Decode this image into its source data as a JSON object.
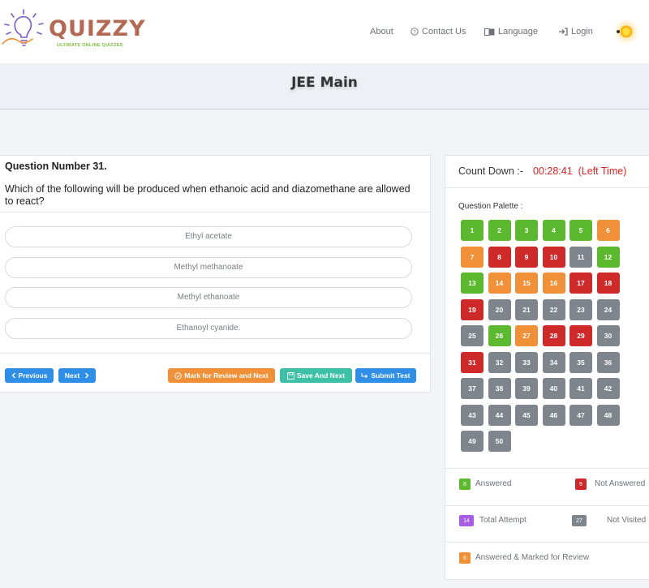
{
  "brand": {
    "name": "QUIZZY",
    "tagline": "ULTIMATE ONLINE QUIZZES"
  },
  "nav": {
    "about": "About",
    "contact": "Contact Us",
    "language": "Language",
    "login": "Login"
  },
  "page": {
    "title": "JEE Main"
  },
  "question": {
    "number_label": "Question Number 31.",
    "text": "Which of the following will be produced when ethanoic acid and diazomethane are allowed to react?",
    "options": [
      "Ethyl acetate",
      "Methyl methanoate",
      "Methyl ethanoate",
      "Ethanoyl cyanide."
    ]
  },
  "buttons": {
    "previous": "Previous",
    "next": "Next",
    "mark_review_next": "Mark for Review and Next",
    "save_next": "Save And Next",
    "submit": "Submit Test"
  },
  "countdown": {
    "label": "Count Down :-",
    "time": "00:28:41",
    "suffix": "(Left Time)"
  },
  "palette": {
    "label": "Question Palette :",
    "colors": {
      "answered": "#5cb82e",
      "not_answered": "#cf2a2a",
      "review": "#f0913a",
      "not_visited": "#7e858d",
      "total": "#a85ee0"
    },
    "statuses": [
      "answered",
      "answered",
      "answered",
      "answered",
      "answered",
      "review",
      "review",
      "not_answered",
      "not_answered",
      "not_answered",
      "not_visited",
      "answered",
      "answered",
      "review",
      "review",
      "review",
      "not_answered",
      "not_answered",
      "not_answered",
      "not_visited",
      "not_visited",
      "not_visited",
      "not_visited",
      "not_visited",
      "not_visited",
      "answered",
      "review",
      "not_answered",
      "not_answered",
      "not_visited",
      "not_answered",
      "not_visited",
      "not_visited",
      "not_visited",
      "not_visited",
      "not_visited",
      "not_visited",
      "not_visited",
      "not_visited",
      "not_visited",
      "not_visited",
      "not_visited",
      "not_visited",
      "not_visited",
      "not_visited",
      "not_visited",
      "not_visited",
      "not_visited",
      "not_visited",
      "not_visited"
    ]
  },
  "legend": {
    "answered": {
      "count": "8",
      "label": "Answered"
    },
    "not_answered": {
      "count": "9",
      "label": "Not Answered"
    },
    "total_attempt": {
      "count": "14",
      "label": "Total Attempt"
    },
    "not_visited": {
      "count": "27",
      "label": "Not Visited"
    },
    "marked_review": {
      "count": "6",
      "label": "Answered & Marked for Review"
    }
  }
}
